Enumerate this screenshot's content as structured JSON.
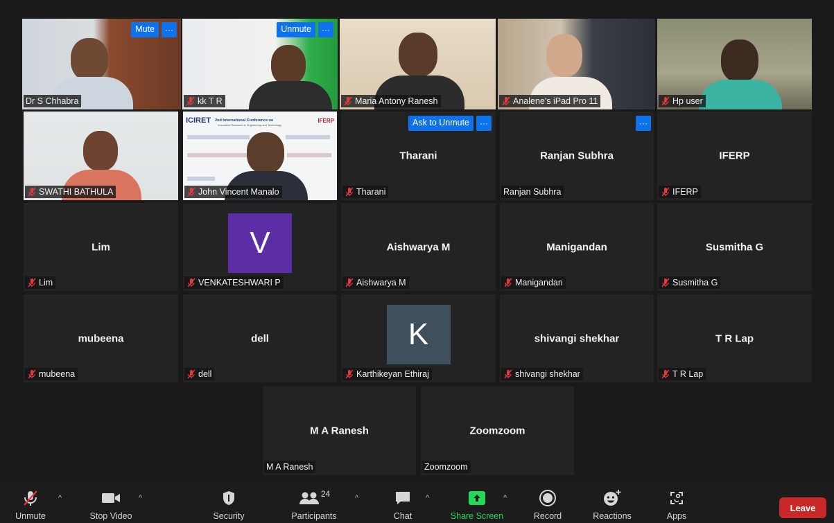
{
  "tiles": {
    "t1": {
      "name": "Dr S Chhabra",
      "btn": "Mute",
      "more": "···"
    },
    "t2": {
      "name": "kk T R",
      "btn": "Unmute",
      "more": "···"
    },
    "t3": {
      "name": "Maria Antony Ranesh"
    },
    "t4": {
      "name": "Analene's iPad Pro 11"
    },
    "t5": {
      "name": "Hp user"
    },
    "t6": {
      "name": "SWATHI BATHULA"
    },
    "t7": {
      "name": "John Vincent Manalo"
    },
    "t8": {
      "name": "Tharani",
      "center": "Tharani",
      "btn": "Ask to Unmute",
      "more": "···"
    },
    "t9": {
      "name": "Ranjan Subhra",
      "center": "Ranjan Subhra",
      "more": "···"
    },
    "t10": {
      "name": "IFERP",
      "center": "IFERP"
    },
    "t11": {
      "name": "Lim",
      "center": "Lim"
    },
    "t12": {
      "name": "VENKATESHWARI P",
      "avatar": "V"
    },
    "t13": {
      "name": "Aishwarya M",
      "center": "Aishwarya M"
    },
    "t14": {
      "name": "Manigandan",
      "center": "Manigandan"
    },
    "t15": {
      "name": "Susmitha G",
      "center": "Susmitha G"
    },
    "t16": {
      "name": "mubeena",
      "center": "mubeena"
    },
    "t17": {
      "name": "dell",
      "center": "dell"
    },
    "t18": {
      "name": "Karthikeyan Ethiraj",
      "avatar": "K"
    },
    "t19": {
      "name": "shivangi shekhar",
      "center": "shivangi shekhar"
    },
    "t20": {
      "name": "T R Lap",
      "center": "T R Lap"
    },
    "t21": {
      "name": "M A Ranesh",
      "center": "M A Ranesh"
    },
    "t22": {
      "name": "Zoomzoom",
      "center": "Zoomzoom"
    }
  },
  "slide": {
    "brand1": "ICIRET",
    "brand2": "IFERP",
    "conf_title": "2nd International Conference on",
    "conf_sub": "Innovative Research in Engineering and Technology"
  },
  "toolbar": {
    "unmute": "Unmute",
    "stop_video": "Stop Video",
    "security": "Security",
    "participants": "Participants",
    "participants_count": "24",
    "chat": "Chat",
    "share_screen": "Share Screen",
    "record": "Record",
    "reactions": "Reactions",
    "apps": "Apps",
    "leave": "Leave"
  },
  "colors": {
    "accent_blue": "#0e72ed",
    "speaker_outline": "#d7e66a",
    "share_green": "#23d959",
    "leave_red": "#c82828",
    "muted_mic_red": "#e0393e",
    "avatar_purple": "#5b2ea6",
    "avatar_slate": "#3f4f5c"
  }
}
